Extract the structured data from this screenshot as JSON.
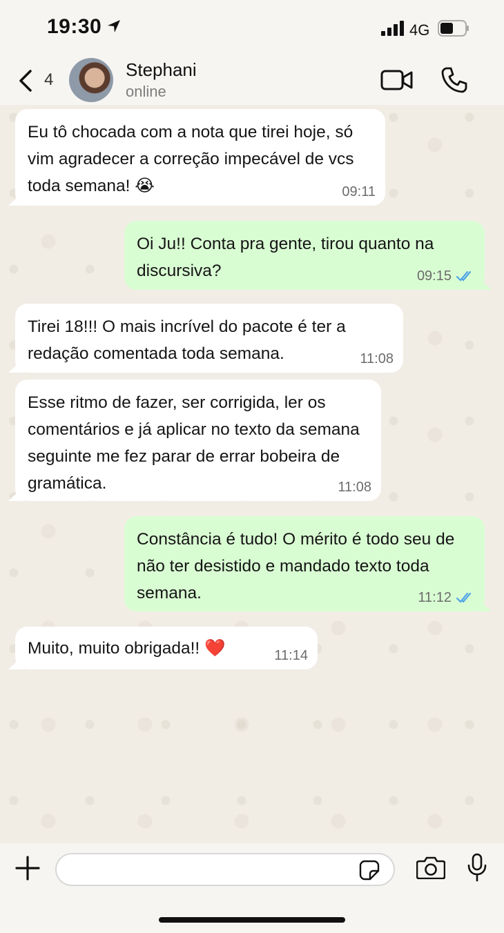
{
  "status_bar": {
    "time": "19:30",
    "network": "4G"
  },
  "header": {
    "unread_count": "4",
    "contact_name": "Stephani",
    "presence": "online"
  },
  "messages": [
    {
      "direction": "in",
      "text": "Eu tô chocada com a nota que tirei hoje, só vim agradecer a correção impecável de vcs toda semana! 😭",
      "time": "09:11"
    },
    {
      "direction": "out",
      "text": "Oi Ju!! Conta pra gente, tirou quanto na discursiva?",
      "time": "09:15",
      "status": "read"
    },
    {
      "direction": "in",
      "text": "Tirei 18!!! O mais incrível do pacote é ter a redação comentada toda semana.",
      "time": "11:08"
    },
    {
      "direction": "in",
      "text": "Esse ritmo de fazer, ser corrigida, ler os comentários e já aplicar no texto da semana seguinte me fez parar de errar bobeira de gramática.",
      "time": "11:08"
    },
    {
      "direction": "out",
      "text": "Constância é tudo! O mérito é todo seu de não ter desistido e mandado texto toda semana.",
      "time": "11:12",
      "status": "read"
    },
    {
      "direction": "in",
      "text": "Muito, muito obrigada!! ❤️",
      "time": "11:14"
    }
  ],
  "composer": {
    "placeholder": ""
  },
  "colors": {
    "incoming_bubble": "#ffffff",
    "outgoing_bubble": "#d9fdd3",
    "read_ticks": "#4fa3e6"
  }
}
